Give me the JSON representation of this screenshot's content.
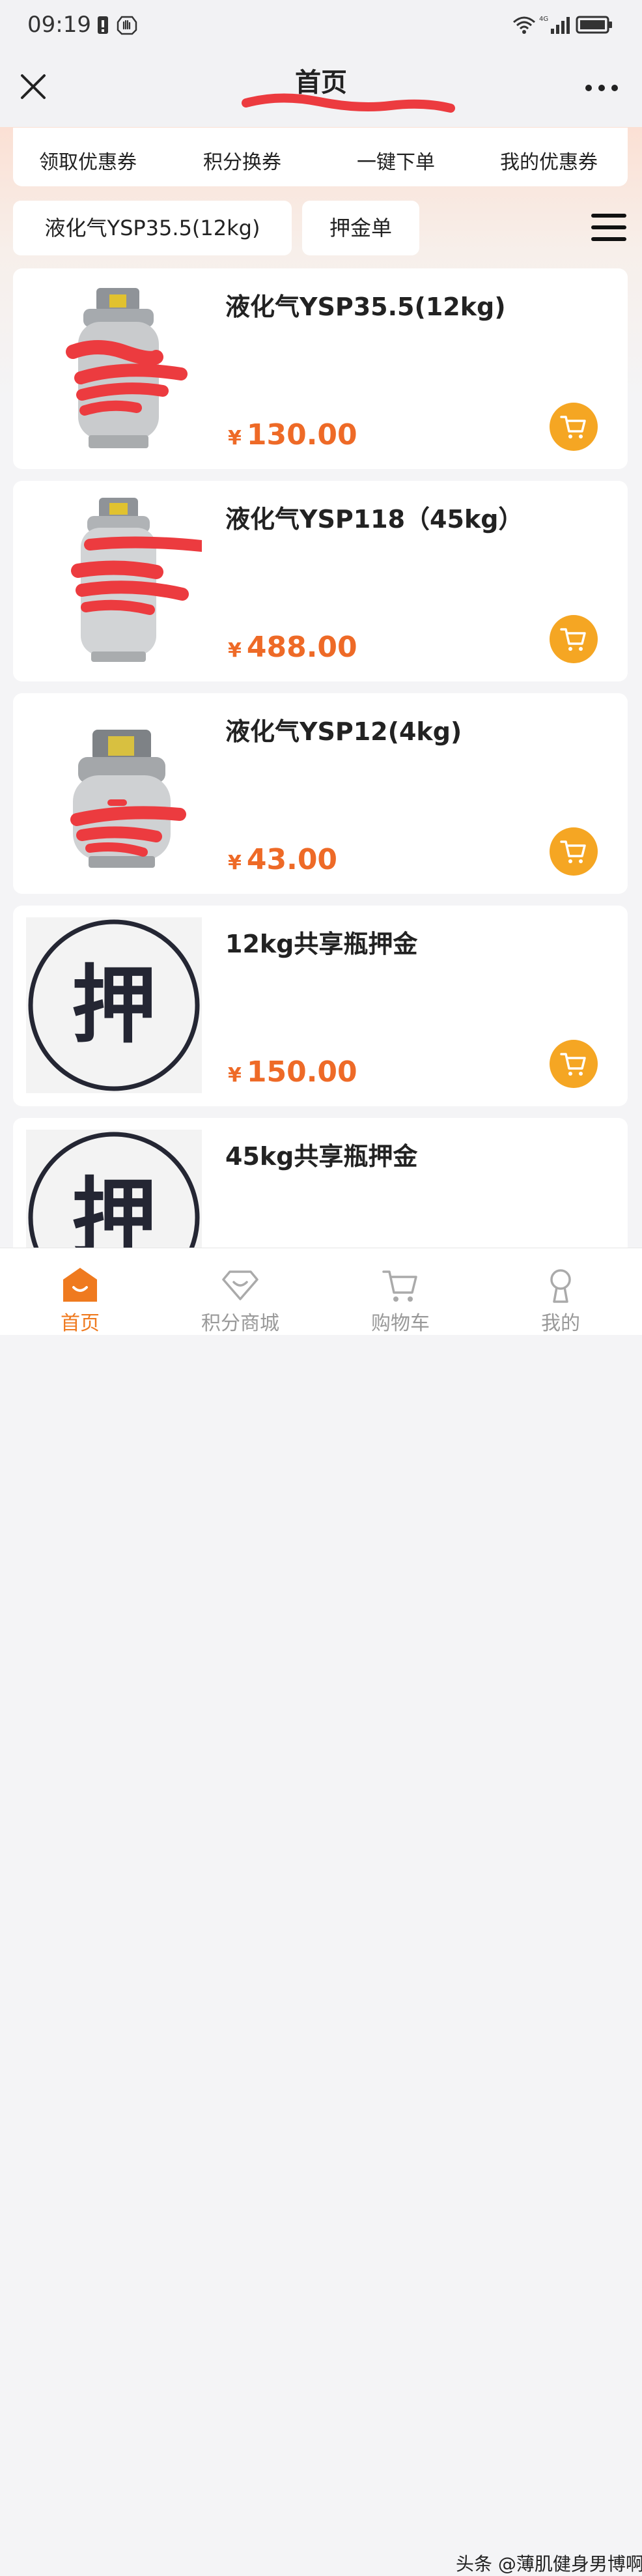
{
  "status_bar": {
    "time": "09:19",
    "network": "4G"
  },
  "header": {
    "title": "首页"
  },
  "quick_actions": [
    "领取优惠券",
    "积分换券",
    "一键下单",
    "我的优惠券"
  ],
  "filters": [
    "液化气YSP35.5(12kg)",
    "押金单"
  ],
  "products": [
    {
      "name": "液化气YSP35.5(12kg)",
      "currency": "¥",
      "price": "130.00",
      "thumb": "gas-cylinder"
    },
    {
      "name": "液化气YSP118（45kg）",
      "currency": "¥",
      "price": "488.00",
      "thumb": "gas-cylinder"
    },
    {
      "name": "液化气YSP12(4kg)",
      "currency": "¥",
      "price": "43.00",
      "thumb": "gas-cylinder"
    },
    {
      "name": "12kg共享瓶押金",
      "currency": "¥",
      "price": "150.00",
      "thumb": "deposit-seal",
      "seal_text": "押"
    },
    {
      "name": "45kg共享瓶押金",
      "thumb": "deposit-seal",
      "seal_text": "押"
    }
  ],
  "tabs": [
    {
      "label": "首页",
      "icon": "home-icon",
      "active": true
    },
    {
      "label": "积分商城",
      "icon": "points-mall-icon",
      "active": false
    },
    {
      "label": "购物车",
      "icon": "cart-icon",
      "active": false
    },
    {
      "label": "我的",
      "icon": "profile-icon",
      "active": false
    }
  ],
  "watermark": "头条 @薄肌健身男博啊",
  "colors": {
    "accent": "#ef7a1f",
    "price": "#ee6a27",
    "cart_button": "#f5a623",
    "redaction": "#ec3b3f"
  }
}
